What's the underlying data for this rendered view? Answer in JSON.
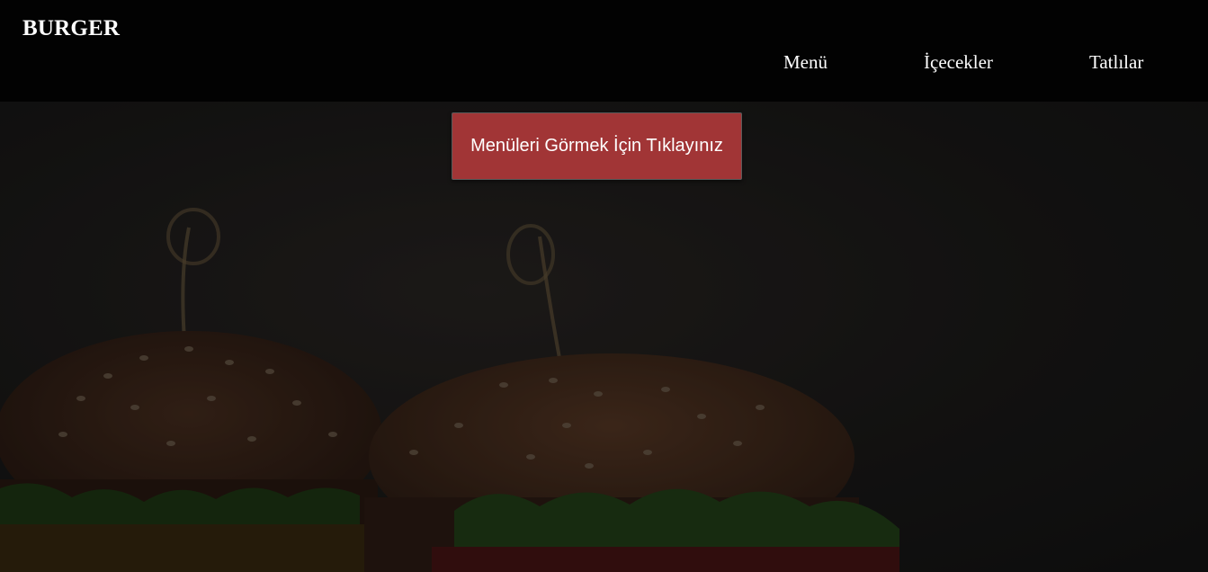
{
  "brand": {
    "title": "BURGER"
  },
  "nav": {
    "items": [
      {
        "label": "Menü"
      },
      {
        "label": "İçecekler"
      },
      {
        "label": "Tatlılar"
      }
    ]
  },
  "hero": {
    "cta_label": "Menüleri Görmek İçin Tıklayınız",
    "background_image": "burger-photo"
  },
  "colors": {
    "navbar_bg": "#020202",
    "cta_bg": "#a13536",
    "text": "#ffffff"
  }
}
